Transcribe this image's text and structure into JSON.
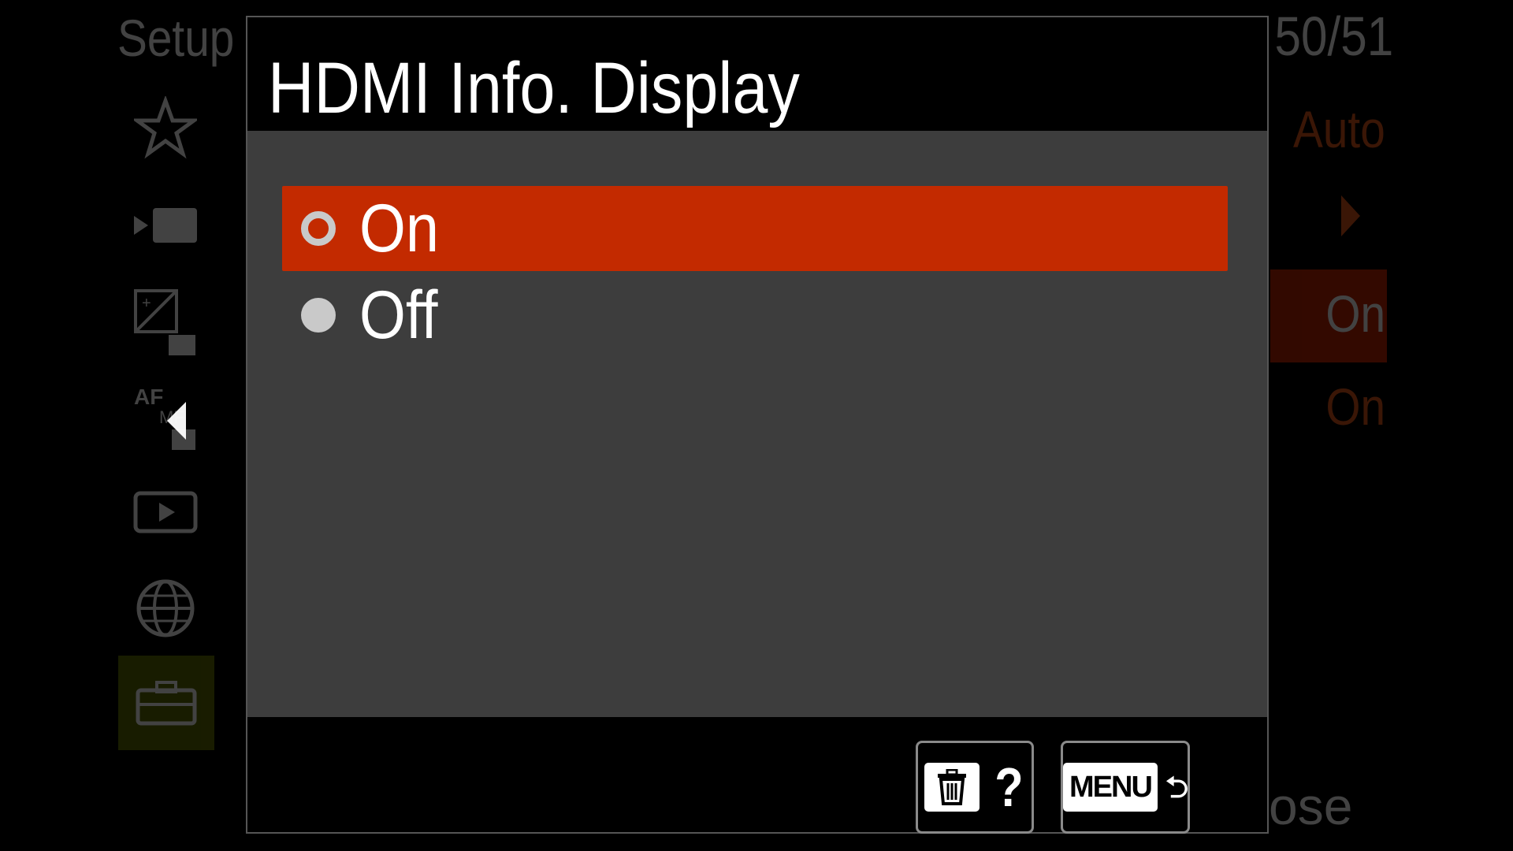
{
  "background_menu": {
    "title": "Setup",
    "page_counter": "50/51",
    "right_values": [
      "Auto",
      "On",
      "On"
    ],
    "close_text": "ose",
    "side_icons": [
      "star-icon",
      "movie-icon",
      "exposure-movie-icon",
      "af-movie-icon",
      "playback-icon",
      "globe-icon",
      "toolbox-icon"
    ]
  },
  "dialog": {
    "title": "HDMI Info. Display",
    "options": [
      {
        "label": "On",
        "selected": true
      },
      {
        "label": "Off",
        "selected": false
      }
    ],
    "footer": {
      "delete_help_label": "?",
      "menu_key_label": "MENU"
    }
  },
  "colors": {
    "selection": "#c32a00",
    "panel": "#3d3d3d",
    "accent_orange": "#e0561a"
  }
}
